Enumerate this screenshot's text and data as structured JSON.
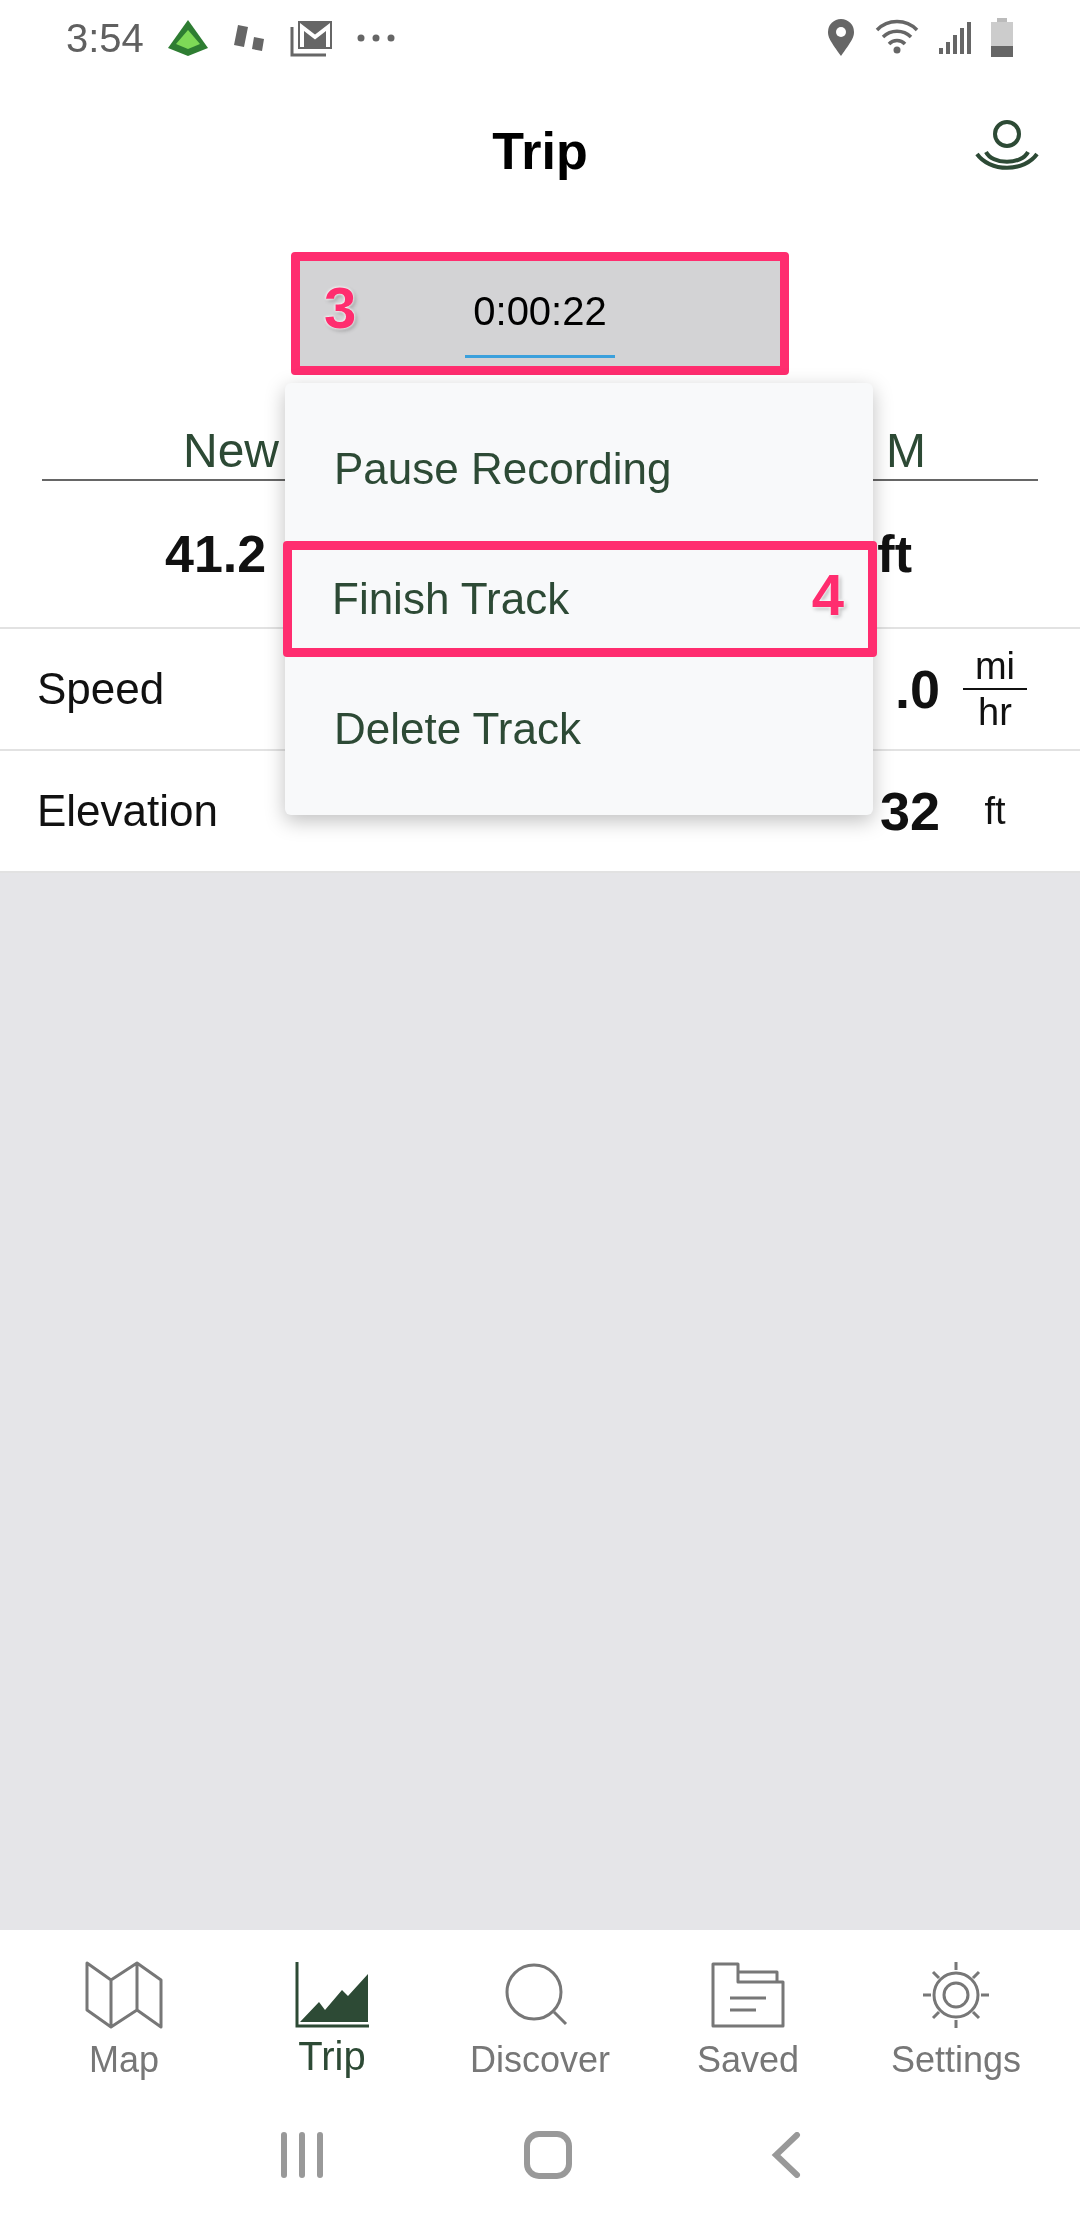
{
  "status_bar": {
    "time": "3:54"
  },
  "header": {
    "title": "Trip"
  },
  "timer": {
    "value": "0:00:22",
    "annotation": "3"
  },
  "track_tabs": [
    "New",
    "M"
  ],
  "summary": [
    "41.2",
    "ft"
  ],
  "stats": [
    {
      "label": "Speed",
      "value": ".0",
      "unit_top": "mi",
      "unit_bottom": "hr",
      "kind": "fraction"
    },
    {
      "label": "Elevation",
      "value": "32",
      "unit": "ft",
      "kind": "plain"
    }
  ],
  "menu": [
    {
      "label": "Pause Recording"
    },
    {
      "label": "Finish Track",
      "annotation": "4"
    },
    {
      "label": "Delete Track"
    }
  ],
  "bottom_nav": [
    {
      "label": "Map",
      "selected": false
    },
    {
      "label": "Trip",
      "selected": true
    },
    {
      "label": "Discover",
      "selected": false
    },
    {
      "label": "Saved",
      "selected": false
    },
    {
      "label": "Settings",
      "selected": false
    }
  ]
}
